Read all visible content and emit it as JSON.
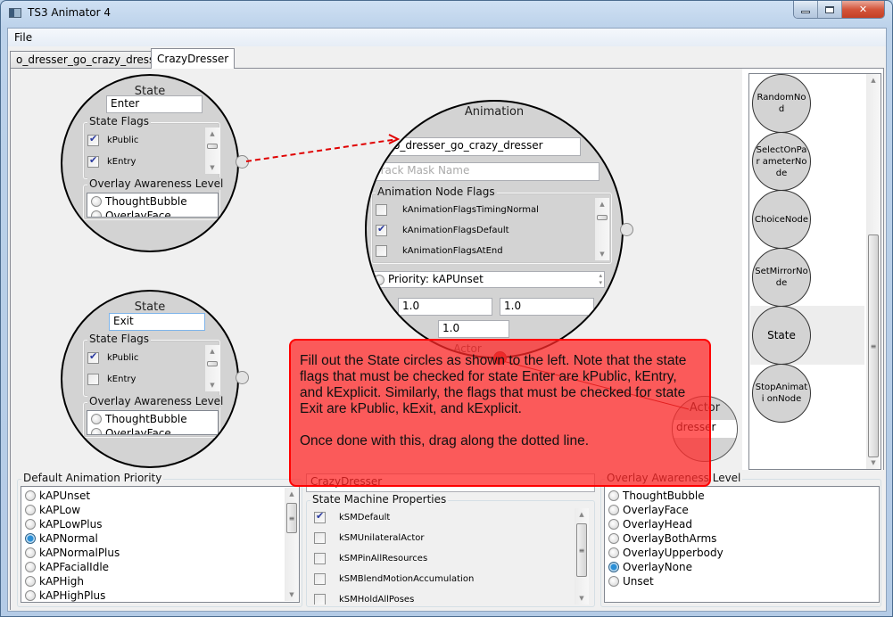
{
  "window": {
    "title": "TS3 Animator 4",
    "controls": {
      "minimize": "minimize",
      "maximize": "maximize",
      "close": "✕"
    }
  },
  "menu": {
    "file": "File"
  },
  "tabs": [
    {
      "label": "o_dresser_go_crazy_dresser",
      "active": false
    },
    {
      "label": "CrazyDresser",
      "active": true
    }
  ],
  "canvas": {
    "state_enter": {
      "title": "State",
      "name": "Enter",
      "flags_label": "State Flags",
      "flags": [
        {
          "label": "kPublic",
          "checked": true
        },
        {
          "label": "kEntry",
          "checked": true
        }
      ],
      "overlay_label": "Overlay Awareness Level",
      "overlay_options": [
        "ThoughtBubble",
        "OverlayFace"
      ]
    },
    "state_exit": {
      "title": "State",
      "name": "Exit",
      "flags_label": "State Flags",
      "flags": [
        {
          "label": "kPublic",
          "checked": true
        },
        {
          "label": "kEntry",
          "checked": false
        }
      ],
      "overlay_label": "Overlay Awareness Level",
      "overlay_options": [
        "ThoughtBubble",
        "OverlayFace"
      ]
    },
    "animation": {
      "title": "Animation",
      "clip_name": "o_dresser_go_crazy_dresser",
      "track_mask_placeholder": "Track Mask Name",
      "flags_label": "Animation Node Flags",
      "flags": [
        {
          "label": "kAnimationFlagsTimingNormal",
          "checked": false
        },
        {
          "label": "kAnimationFlagsDefault",
          "checked": true
        },
        {
          "label": "kAnimationFlagsAtEnd",
          "checked": false
        }
      ],
      "priority": "Priority: kAPUnset",
      "value1": "1.0",
      "value2": "1.0",
      "value3": "1.0",
      "actor_label": "Actor"
    },
    "actor": {
      "title": "Actor",
      "name": "dresser"
    }
  },
  "instruction": {
    "paragraph1": "Fill out the State circles as shown to the left. Note that the state flags that must be checked for state Enter are kPublic, kEntry, and kExplicit. Similarly, the flags that must be checked for state Exit are kPublic, kExit, and kExplicit.",
    "paragraph2": "Once done with this, drag along the dotted line."
  },
  "toolbox": {
    "items": [
      "RandomNode",
      "SelectOnParameterNode",
      "ChoiceNode",
      "SetMirrorNode",
      "State",
      "StopAnimationNode"
    ],
    "visible_labels": [
      "RandomNod",
      "SelectOnPar ameterNode",
      "ChoiceNode",
      "SetMirrorNo de",
      "State",
      "StopAnimati onNode"
    ],
    "selected": "State"
  },
  "bottom": {
    "priority": {
      "label": "Default Animation Priority",
      "options": [
        "kAPUnset",
        "kAPLow",
        "kAPLowPlus",
        "kAPNormal",
        "kAPNormalPlus",
        "kAPFacialIdle",
        "kAPHigh",
        "kAPHighPlus"
      ],
      "selected": "kAPNormal"
    },
    "state_machine": {
      "name": "CrazyDresser",
      "props_label": "State Machine Properties",
      "props": [
        {
          "label": "kSMDefault",
          "checked": true
        },
        {
          "label": "kSMUnilateralActor",
          "checked": false
        },
        {
          "label": "kSMPinAllResources",
          "checked": false
        },
        {
          "label": "kSMBlendMotionAccumulation",
          "checked": false
        },
        {
          "label": "kSMHoldAllPoses",
          "checked": false
        }
      ]
    },
    "overlay": {
      "label": "Overlay Awareness Level",
      "options": [
        "ThoughtBubble",
        "OverlayFace",
        "OverlayHead",
        "OverlayBothArms",
        "OverlayUpperbody",
        "OverlayNone",
        "Unset"
      ],
      "selected": "OverlayNone"
    }
  },
  "colors": {
    "note_fill": "#ff2828",
    "dashed_link": "#e00000",
    "radio_selected": "#2b8fd6"
  }
}
